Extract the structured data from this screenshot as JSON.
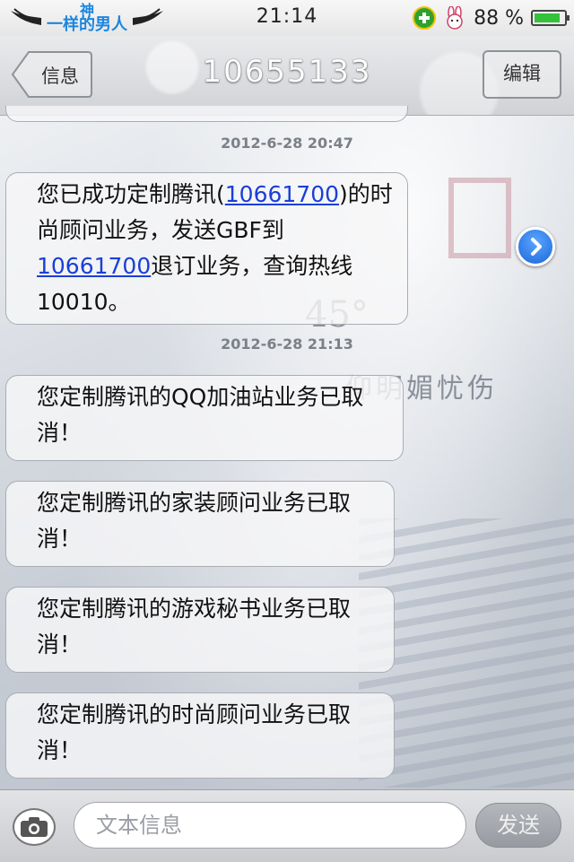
{
  "status_bar": {
    "logo_line1": "神",
    "logo_line2": "一样的男人",
    "time": "21:14",
    "battery_percent": "88 %",
    "battery_level": 0.88,
    "icons": [
      "wings-icon",
      "plus-app-icon",
      "bunny-icon",
      "battery-icon"
    ]
  },
  "nav": {
    "back_label": "信息",
    "title": "10655133",
    "edit_label": "编辑"
  },
  "messages": [
    {
      "timestamp": "2012-6-28 20:47",
      "segments": [
        {
          "text": "您已成功定制腾讯",
          "link": false
        },
        {
          "text": "(",
          "link": false
        },
        {
          "text": "10661700",
          "link": true
        },
        {
          "text": ")的时尚顾问业务，发送GBF到",
          "link": false
        },
        {
          "text": "10661700",
          "link": true
        },
        {
          "text": "退订业务，查询热线10010。",
          "link": false
        }
      ]
    },
    {
      "timestamp": "2012-6-28 21:13",
      "text": "您定制腾讯的QQ加油站业务已取消！"
    },
    {
      "text": "您定制腾讯的家装顾问业务已取消！"
    },
    {
      "text": "您定制腾讯的游戏秘书业务已取消！"
    },
    {
      "text": "您定制腾讯的时尚顾问业务已取消！"
    }
  ],
  "wallpaper_text": {
    "line1": "45°",
    "line2": "仰明媚忧伤"
  },
  "input": {
    "placeholder": "文本信息",
    "send_label": "发送"
  },
  "colors": {
    "link": "#1a3fd8",
    "logo_blue": "#1a86e0",
    "detail_button": "#1c66d6"
  }
}
